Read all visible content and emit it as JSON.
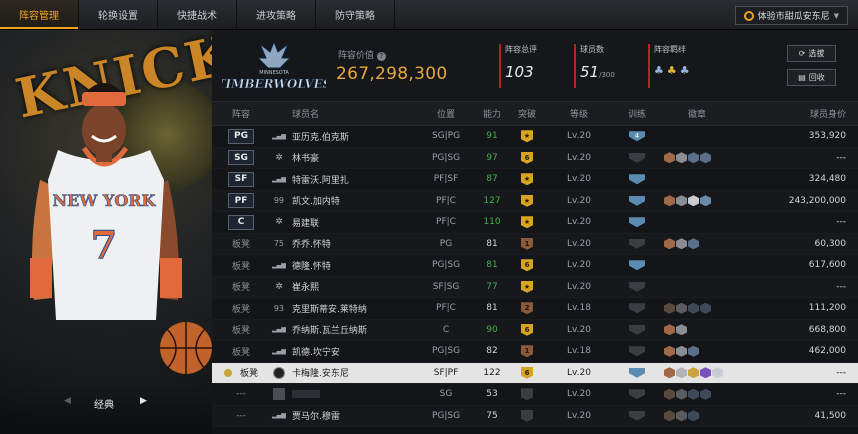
{
  "nav": {
    "tabs": [
      "阵容管理",
      "轮换设置",
      "快捷战术",
      "进攻策略",
      "防守策略"
    ],
    "active_index": 0,
    "version_label": "体验市甜瓜安东尼"
  },
  "left_panel": {
    "player_jersey_text": "NEW YORK",
    "jersey_number": "7",
    "background_logo_text": "KNICKS",
    "shoe_label": "经典"
  },
  "team": {
    "city_text": "MINNESOTA",
    "name_text": "TIMBERWOLVES",
    "value_label": "阵容价值",
    "value": "267,298,300"
  },
  "stats": {
    "rating_label": "阵容总评",
    "rating": "103",
    "count_label": "球员数",
    "count": "51",
    "count_max": "/300",
    "bonds_label": "阵容羁绊"
  },
  "buttons": {
    "select": "选拔",
    "recycle": "回收"
  },
  "table": {
    "headers": [
      "阵容",
      "球员名",
      "位置",
      "能力",
      "突破",
      "等级",
      "训练",
      "徽章",
      "球员身价"
    ],
    "rows": [
      {
        "slot": "PG",
        "prefix": "signal",
        "name": "亚历克.伯克斯",
        "pos": "SG|PG",
        "ovr": "91",
        "ovr_color": "#3fb24a",
        "brk": "gold",
        "brk_text": "★",
        "lv": "Lv.20",
        "trn": "blue",
        "trn_text": "4",
        "badges": [],
        "salary": "353,920"
      },
      {
        "slot": "SG",
        "prefix": "star",
        "name": "林书豪",
        "pos": "PG|SG",
        "ovr": "97",
        "ovr_color": "#3fb24a",
        "brk": "gold",
        "brk_text": "6",
        "lv": "Lv.20",
        "trn": "dim",
        "trn_text": "",
        "badges": [
          "#a06a48",
          "#8a8d92",
          "#5b6e8a",
          "#5b6e8a"
        ],
        "salary": "---"
      },
      {
        "slot": "SF",
        "prefix": "signal",
        "name": "特雷沃.阿里扎",
        "pos": "PF|SF",
        "ovr": "87",
        "ovr_color": "#3fb24a",
        "brk": "gold",
        "brk_text": "★",
        "lv": "Lv.20",
        "trn": "blue",
        "trn_text": "",
        "badges": [],
        "salary": "324,480"
      },
      {
        "slot": "PF",
        "prefix": "99",
        "name": "凯文.加内特",
        "pos": "PF|C",
        "ovr": "127",
        "ovr_color": "#3fb24a",
        "brk": "gold",
        "brk_text": "★",
        "lv": "Lv.20",
        "trn": "blue",
        "trn_text": "",
        "badges": [
          "#a06a48",
          "#8a8d92",
          "#c9ccd0",
          "#6a8aa8"
        ],
        "salary": "243,200,000"
      },
      {
        "slot": "C",
        "prefix": "star",
        "name": "易建联",
        "pos": "PF|C",
        "ovr": "110",
        "ovr_color": "#3fb24a",
        "brk": "gold",
        "brk_text": "★",
        "lv": "Lv.20",
        "trn": "blue",
        "trn_text": "",
        "badges": [],
        "salary": "---"
      },
      {
        "slot": "板凳",
        "prefix": "75",
        "name": "乔乔.怀特",
        "pos": "PG",
        "ovr": "81",
        "ovr_color": "#d3d6d9",
        "brk": "bronze",
        "brk_text": "1",
        "lv": "Lv.20",
        "trn": "dim",
        "trn_text": "",
        "badges": [
          "#a06a48",
          "#8a8d92",
          "#5b6e8a"
        ],
        "salary": "60,300"
      },
      {
        "slot": "板凳",
        "prefix": "signal",
        "name": "德隆.怀特",
        "pos": "PG|SG",
        "ovr": "81",
        "ovr_color": "#3fb24a",
        "brk": "gold",
        "brk_text": "6",
        "lv": "Lv.20",
        "trn": "blue",
        "trn_text": "",
        "badges": [],
        "salary": "617,600"
      },
      {
        "slot": "板凳",
        "prefix": "star",
        "name": "崔永熙",
        "pos": "SF|SG",
        "ovr": "77",
        "ovr_color": "#3fb24a",
        "brk": "gold",
        "brk_text": "★",
        "lv": "Lv.20",
        "trn": "dim",
        "trn_text": "",
        "badges": [],
        "salary": "---"
      },
      {
        "slot": "板凳",
        "prefix": "93",
        "name": "克里斯蒂安.莱特纳",
        "pos": "PF|C",
        "ovr": "81",
        "ovr_color": "#d3d6d9",
        "brk": "bronze",
        "brk_text": "2",
        "lv": "Lv.18",
        "trn": "dim",
        "trn_text": "",
        "badges": [
          "#5a4a3e",
          "#5a5c60",
          "#3e4a5a",
          "#3e4a5a"
        ],
        "salary": "111,200"
      },
      {
        "slot": "板凳",
        "prefix": "signal",
        "name": "乔纳斯.瓦兰丘纳斯",
        "pos": "C",
        "ovr": "90",
        "ovr_color": "#3fb24a",
        "brk": "gold",
        "brk_text": "6",
        "lv": "Lv.20",
        "trn": "dim",
        "trn_text": "",
        "badges": [
          "#a06a48",
          "#8a8d92"
        ],
        "salary": "668,800"
      },
      {
        "slot": "板凳",
        "prefix": "signal",
        "name": "凯德.坎宁安",
        "pos": "PG|SG",
        "ovr": "82",
        "ovr_color": "#d3d6d9",
        "brk": "bronze",
        "brk_text": "1",
        "lv": "Lv.18",
        "trn": "dim",
        "trn_text": "",
        "badges": [
          "#a06a48",
          "#8a8d92",
          "#5b6e8a"
        ],
        "salary": "462,000"
      },
      {
        "slot": "板凳",
        "prefix": "cards",
        "name": "卡梅隆.安东尼",
        "pos": "SF|PF",
        "ovr": "122",
        "ovr_color": "#1a1a1a",
        "brk": "gold",
        "brk_text": "6",
        "lv": "Lv.20",
        "trn": "blue",
        "trn_text": "",
        "badges": [
          "#a06a48",
          "#b0b3b7",
          "#c9a43a",
          "#7a4fc0",
          "#c9ccd0"
        ],
        "salary": "---",
        "selected": true
      },
      {
        "slot": "---",
        "prefix": "avatar",
        "name": "",
        "pos": "SG",
        "ovr": "53",
        "ovr_color": "#d3d6d9",
        "brk": "grey",
        "brk_text": "",
        "lv": "Lv.20",
        "trn": "dim",
        "trn_text": "",
        "badges": [
          "#5a4a3e",
          "#5a5c60",
          "#3e4a5a",
          "#3e4a5a"
        ],
        "salary": "---"
      },
      {
        "slot": "---",
        "prefix": "signal",
        "name": "贾马尔.穆雷",
        "pos": "PG|SG",
        "ovr": "75",
        "ovr_color": "#d3d6d9",
        "brk": "grey",
        "brk_text": "",
        "lv": "Lv.20",
        "trn": "dim",
        "trn_text": "",
        "badges": [
          "#5a4a3e",
          "#5a5c60",
          "#3e4a5a"
        ],
        "salary": "41,500"
      }
    ]
  },
  "colors": {
    "accent": "#f0a21c",
    "value": "#e8a83a",
    "green": "#3fb24a",
    "stat_bar": "#b2251f"
  }
}
